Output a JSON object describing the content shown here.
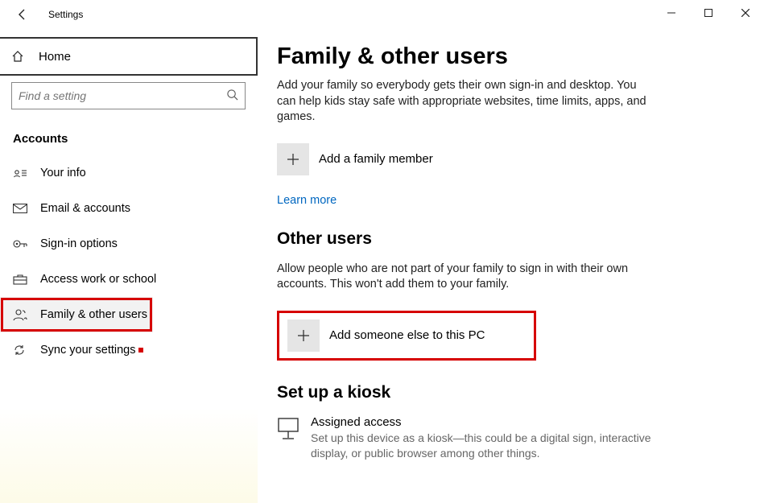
{
  "titlebar": {
    "title": "Settings"
  },
  "sidebar": {
    "home_label": "Home",
    "search_placeholder": "Find a setting",
    "section_label": "Accounts",
    "items": [
      {
        "label": "Your info"
      },
      {
        "label": "Email & accounts"
      },
      {
        "label": "Sign-in options"
      },
      {
        "label": "Access work or school"
      },
      {
        "label": "Family & other users"
      },
      {
        "label": "Sync your settings"
      }
    ]
  },
  "main": {
    "title": "Family & other users",
    "family_desc": "Add your family so everybody gets their own sign-in and desktop. You can help kids stay safe with appropriate websites, time limits, apps, and games.",
    "add_family_label": "Add a family member",
    "learn_more": "Learn more",
    "other_users_title": "Other users",
    "other_users_desc": "Allow people who are not part of your family to sign in with their own accounts. This won't add them to your family.",
    "add_someone_label": "Add someone else to this PC",
    "kiosk_title": "Set up a kiosk",
    "kiosk_heading": "Assigned access",
    "kiosk_desc": "Set up this device as a kiosk—this could be a digital sign, interactive display, or public browser among other things."
  }
}
